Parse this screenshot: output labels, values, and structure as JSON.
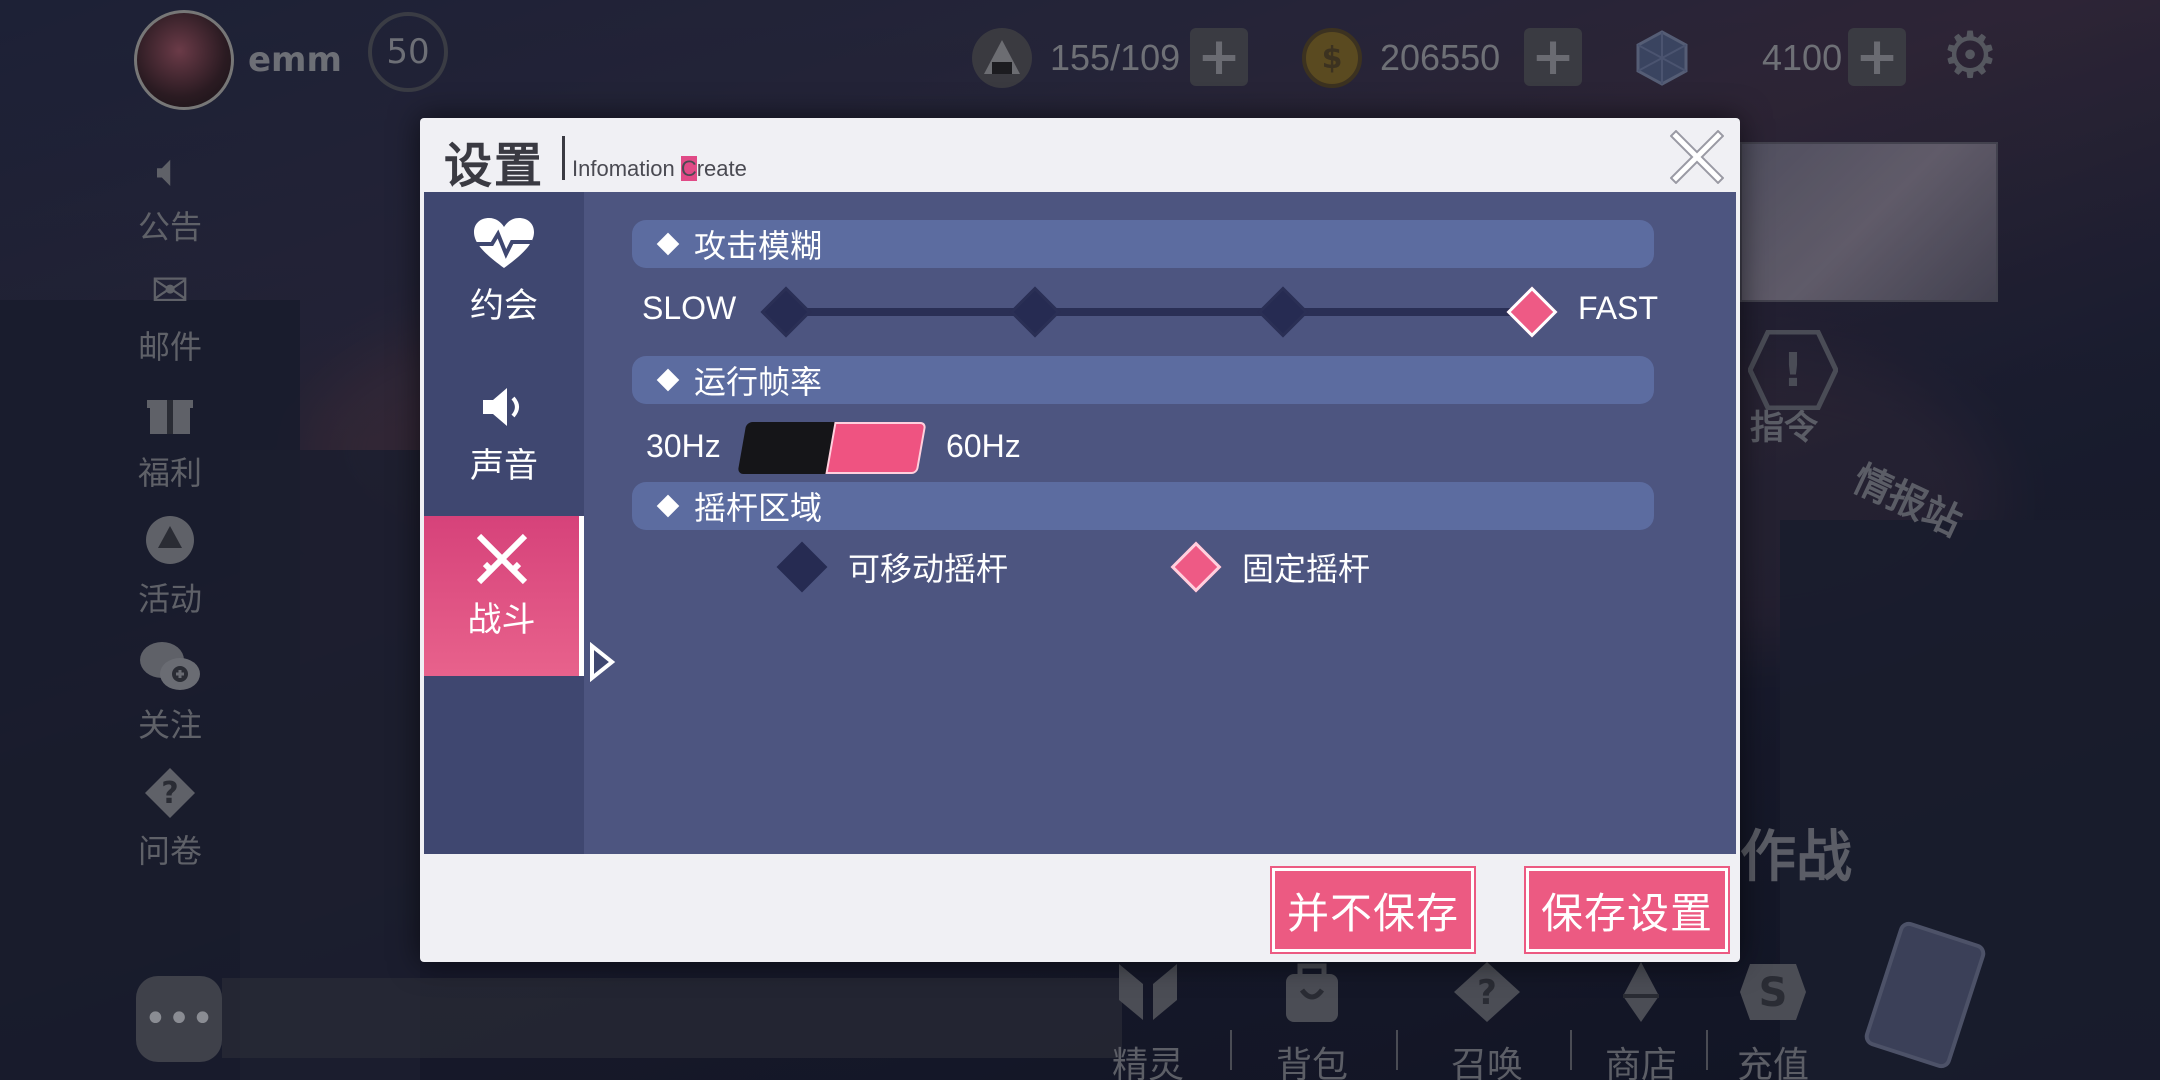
{
  "player": {
    "name": "emm",
    "level": "50"
  },
  "resources": [
    {
      "icon": "rice-ball-icon",
      "value": "155/109"
    },
    {
      "icon": "coin-icon",
      "value": "206550"
    },
    {
      "icon": "crystal-icon",
      "value": "4100"
    }
  ],
  "left_menu": [
    {
      "icon": "speaker-icon",
      "label": "公告"
    },
    {
      "icon": "mail-icon",
      "label": "邮件"
    },
    {
      "icon": "gift-icon",
      "label": "福利"
    },
    {
      "icon": "event-icon",
      "label": "活动"
    },
    {
      "icon": "wechat-icon",
      "label": "关注"
    },
    {
      "icon": "question-icon",
      "label": "问卷"
    }
  ],
  "right_labels": {
    "command": "指令",
    "intel": "情报站",
    "battle": "作战"
  },
  "bottom_nav": [
    {
      "icon": "spirit-icon",
      "label": "精灵"
    },
    {
      "icon": "bag-icon",
      "label": "背包"
    },
    {
      "icon": "summon-icon",
      "label": "召唤"
    },
    {
      "icon": "shop-icon",
      "label": "商店"
    },
    {
      "icon": "recharge-icon",
      "label": "充值"
    }
  ],
  "chat": {
    "button": "•••"
  },
  "settings": {
    "title": "设置",
    "subtitle_pre": "Infomation ",
    "subtitle_hl": "C",
    "subtitle_post": "reate",
    "tabs": [
      {
        "icon": "heart-icon",
        "label": "约会",
        "active": false
      },
      {
        "icon": "speaker-icon",
        "label": "声音",
        "active": false
      },
      {
        "icon": "swords-icon",
        "label": "战斗",
        "active": true
      }
    ],
    "attack_blur": {
      "header": "攻击模糊",
      "min_label": "SLOW",
      "max_label": "FAST",
      "steps": 4,
      "selected_index": 3
    },
    "frame_rate": {
      "header": "运行帧率",
      "low_label": "30Hz",
      "high_label": "60Hz",
      "selected": "60Hz"
    },
    "joystick": {
      "header": "摇杆区域",
      "options": [
        "可移动摇杆",
        "固定摇杆"
      ],
      "selected": "固定摇杆"
    },
    "buttons": {
      "discard": "并不保存",
      "save": "保存设置"
    }
  },
  "colors": {
    "accent_pink": "#ec5a82",
    "panel_blue": "#4d5580",
    "header_blue": "#5c6ca0"
  }
}
